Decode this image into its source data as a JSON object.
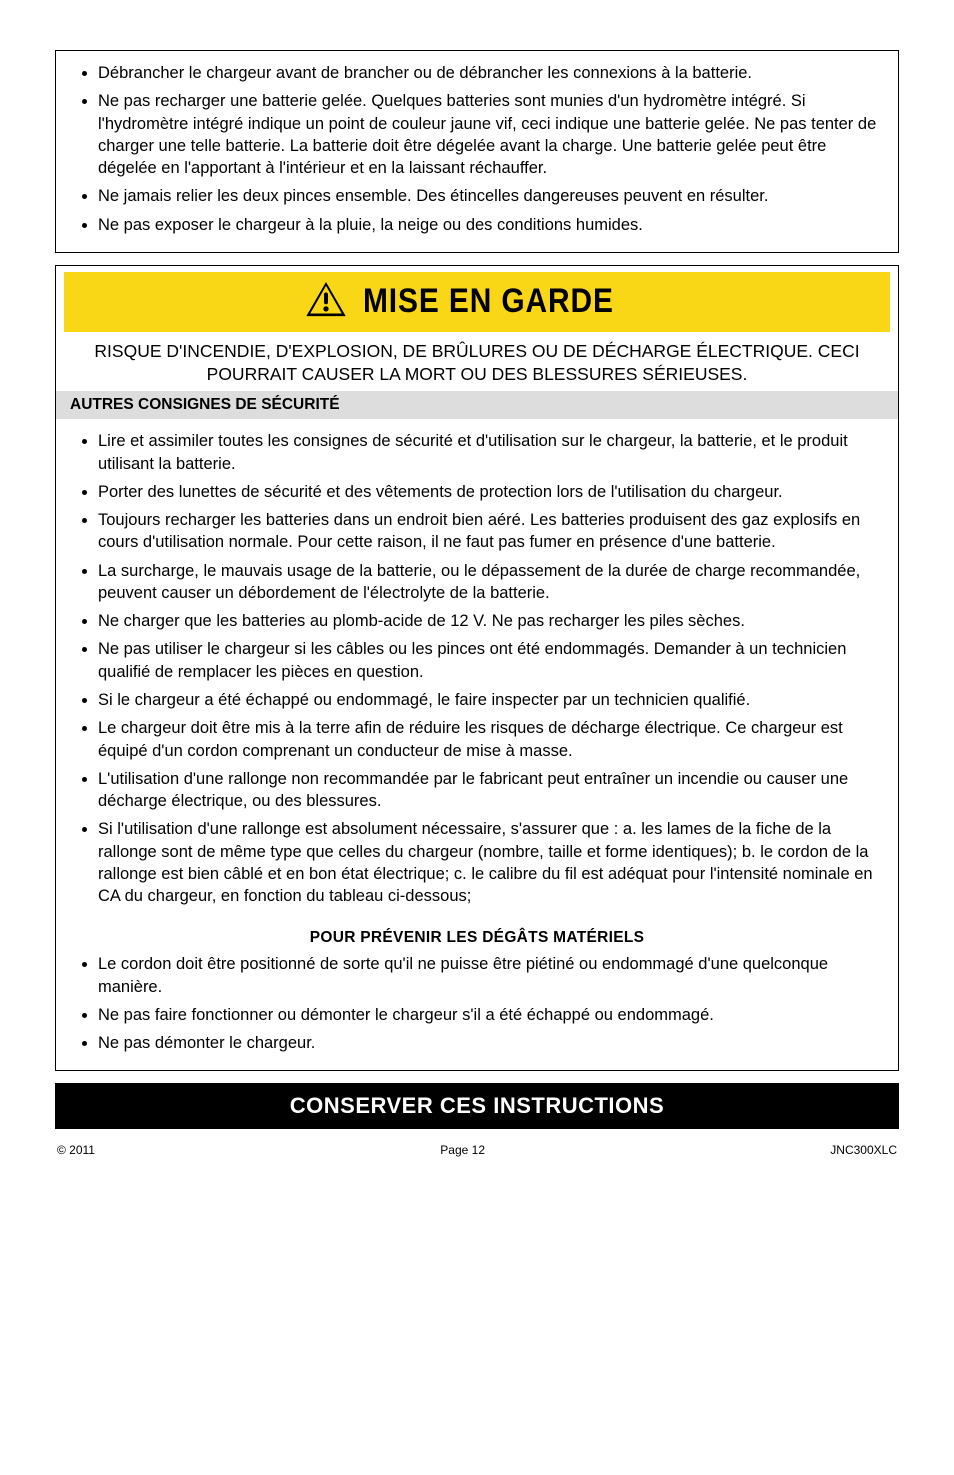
{
  "box1": {
    "items": [
      "Débrancher le chargeur avant de brancher ou de débrancher les connexions à la batterie.",
      "Ne pas recharger une batterie gelée. Quelques batteries sont munies d'un hydromètre intégré. Si l'hydromètre intégré indique un point de couleur jaune vif, ceci indique une batterie gelée. Ne pas tenter de charger une telle batterie. La batterie doit être dégelée avant la charge. Une batterie gelée peut être dégelée en l'apportant à l'intérieur et en la laissant réchauffer.",
      "Ne jamais relier les deux pinces ensemble. Des étincelles dangereuses peuvent en résulter.",
      "Ne pas exposer le chargeur à la pluie, la neige ou des conditions humides."
    ]
  },
  "banner": {
    "label": "MISE EN GARDE"
  },
  "subhead": "RISQUE D'INCENDIE, D'EXPLOSION, DE BRÛLURES OU DE DÉCHARGE ÉLECTRIQUE. CECI POURRAIT CAUSER LA MORT OU DES BLESSURES SÉRIEUSES.",
  "section_header": "AUTRES CONSIGNES DE SÉCURITÉ",
  "box2": {
    "items": [
      "Lire et assimiler toutes les consignes de sécurité et d'utilisation sur le chargeur, la batterie, et le produit utilisant la batterie.",
      "Porter des lunettes de sécurité et des vêtements de protection lors de l'utilisation du chargeur.",
      "Toujours recharger les batteries dans un endroit bien aéré. Les batteries produisent des gaz explosifs en cours d'utilisation normale. Pour cette raison, il ne faut pas fumer en présence d'une batterie.",
      "La surcharge, le mauvais usage de la batterie, ou le dépassement de la durée de charge recommandée, peuvent causer un débordement de l'électrolyte de la batterie.",
      "Ne charger que les batteries au plomb-acide de 12 V. Ne pas recharger les piles sèches.",
      "Ne pas utiliser le chargeur si les câbles ou les pinces ont été endommagés. Demander à un technicien qualifié de remplacer les pièces en question.",
      "Si le chargeur a été échappé ou endommagé, le faire inspecter par un technicien qualifié.",
      "Le chargeur doit être mis à la terre afin de réduire les risques de décharge électrique. Ce chargeur est équipé d'un cordon comprenant un conducteur de mise à masse.",
      "L'utilisation d'une rallonge non recommandée par le fabricant peut entraîner un incendie ou causer une décharge électrique, ou des blessures.",
      "Si l'utilisation d'une rallonge est absolument nécessaire, s'assurer que : a. les lames de la fiche de la rallonge sont de même type que celles du chargeur (nombre, taille et forme identiques); b. le cordon de la rallonge est bien câblé et en bon état électrique; c. le calibre du fil est adéquat pour l'intensité nominale en CA du chargeur, en fonction du tableau ci-dessous;"
    ]
  },
  "pour_prevenir": "POUR PRÉVENIR LES DÉGÂTS MATÉRIELS",
  "box3": {
    "items": [
      "Le cordon doit être positionné de sorte qu'il ne puisse être piétiné ou endommagé d'une quelconque manière.",
      "Ne pas faire fonctionner ou démonter le chargeur s'il a été échappé ou endommagé.",
      "Ne pas démonter le chargeur."
    ]
  },
  "black_banner": "CONSERVER CES INSTRUCTIONS",
  "footer": {
    "left": "© 2011",
    "center": "Page 12",
    "right": "JNC300XLC"
  }
}
